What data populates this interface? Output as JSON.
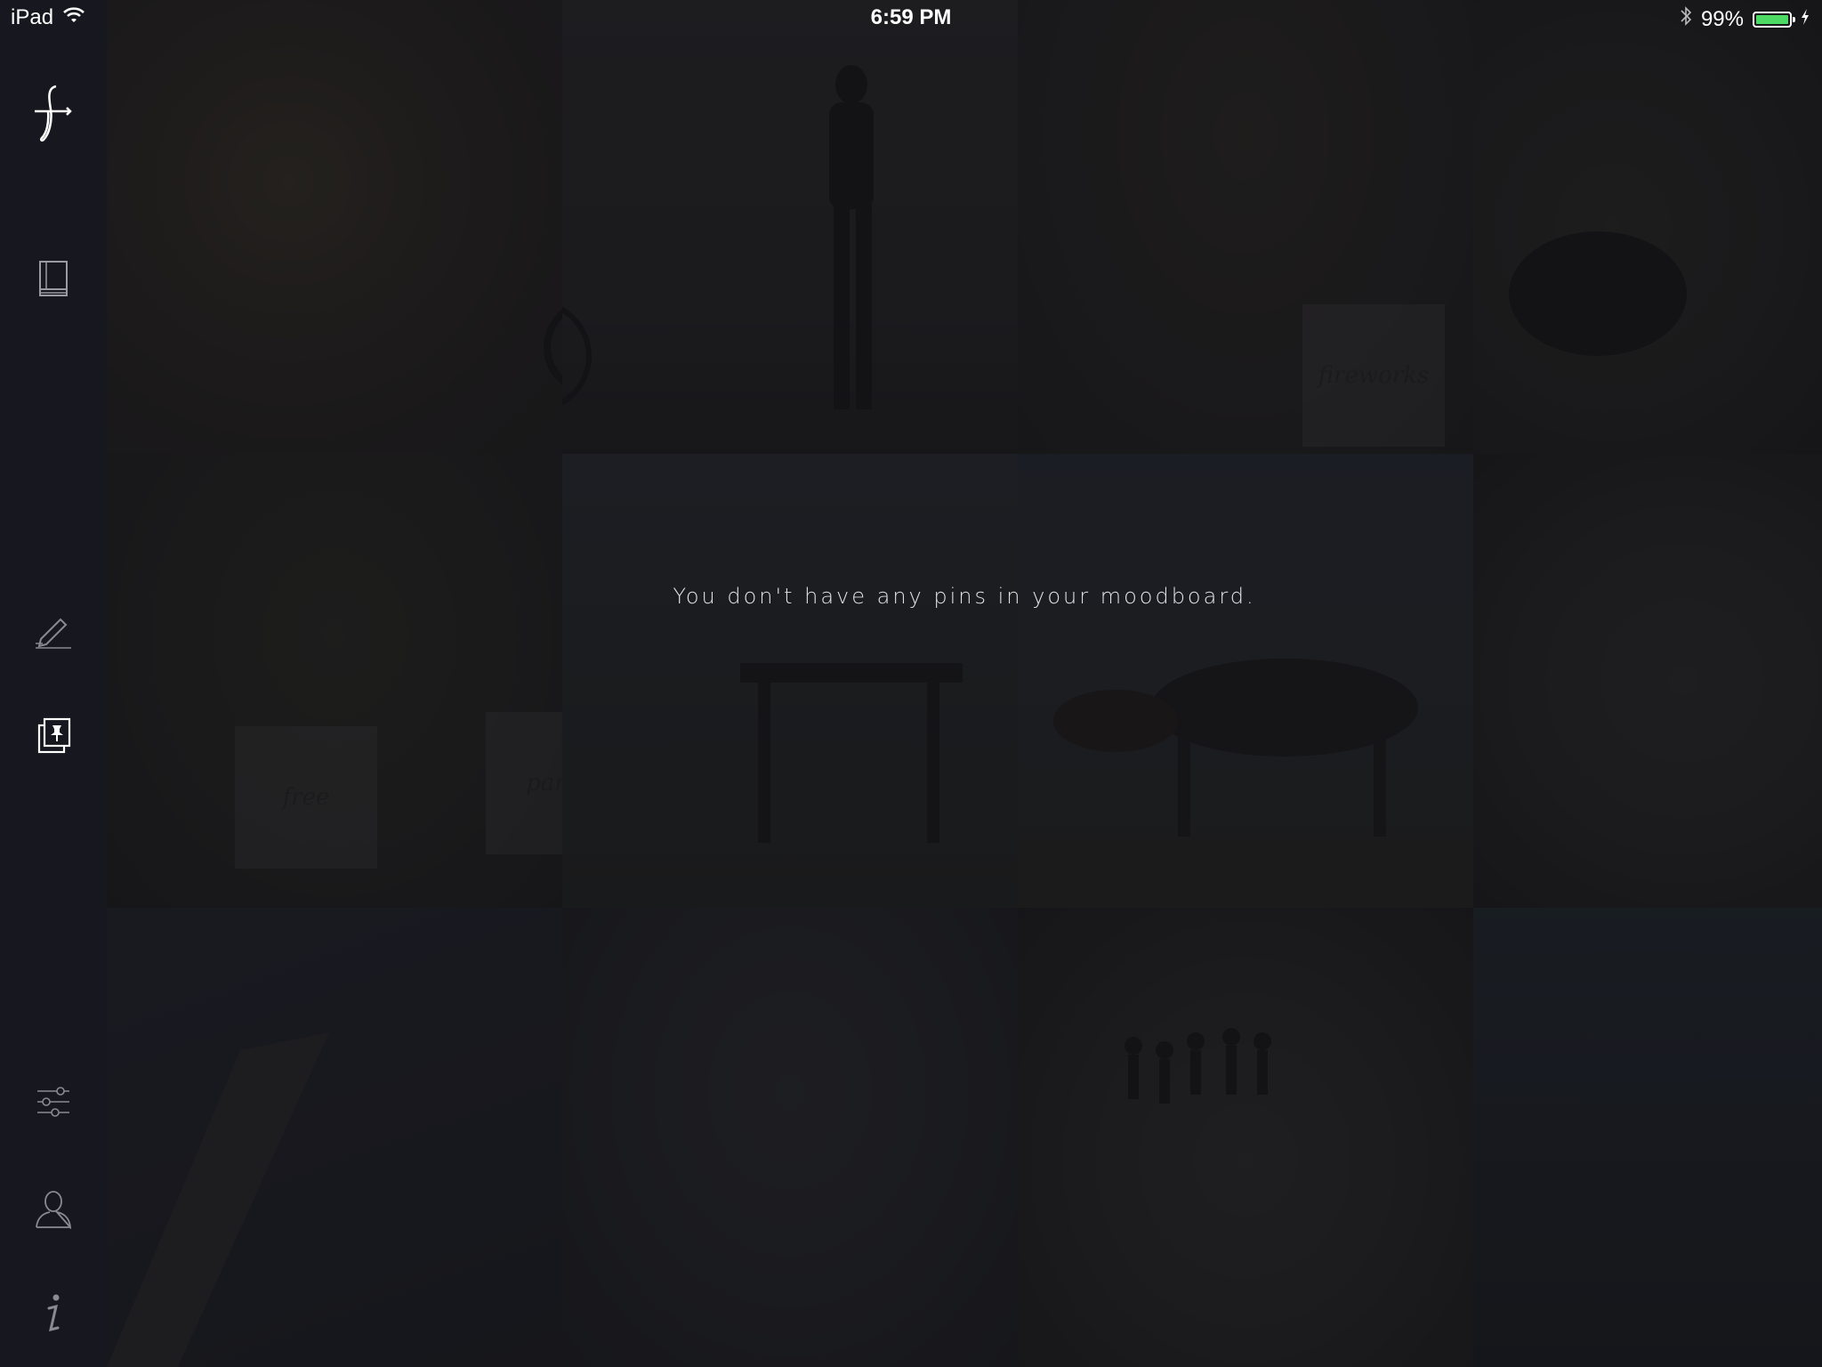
{
  "status_bar": {
    "device": "iPad",
    "time": "6:59 PM",
    "battery_percent": "99%",
    "battery_level": 0.99,
    "icons": [
      "wifi-icon",
      "bluetooth-icon",
      "battery-icon",
      "charging-icon"
    ]
  },
  "sidebar": {
    "items": [
      {
        "name": "logo",
        "icon": "script-f-logo-icon"
      },
      {
        "name": "journal",
        "icon": "book-icon"
      },
      {
        "name": "write",
        "icon": "pen-icon"
      },
      {
        "name": "moodboard",
        "icon": "pinned-cards-icon",
        "active": true
      },
      {
        "name": "settings",
        "icon": "sliders-icon"
      },
      {
        "name": "profile",
        "icon": "person-icon"
      },
      {
        "name": "info",
        "icon": "info-icon"
      }
    ]
  },
  "background_notes": {
    "note1": "fireworks",
    "note2": "free",
    "note3": "party"
  },
  "main": {
    "empty_message": "You don't have any pins in your moodboard."
  },
  "colors": {
    "background": "#1a1b1e",
    "sidebar": "#17171f",
    "text": "#e2e2e6",
    "battery": "#4cd964"
  }
}
